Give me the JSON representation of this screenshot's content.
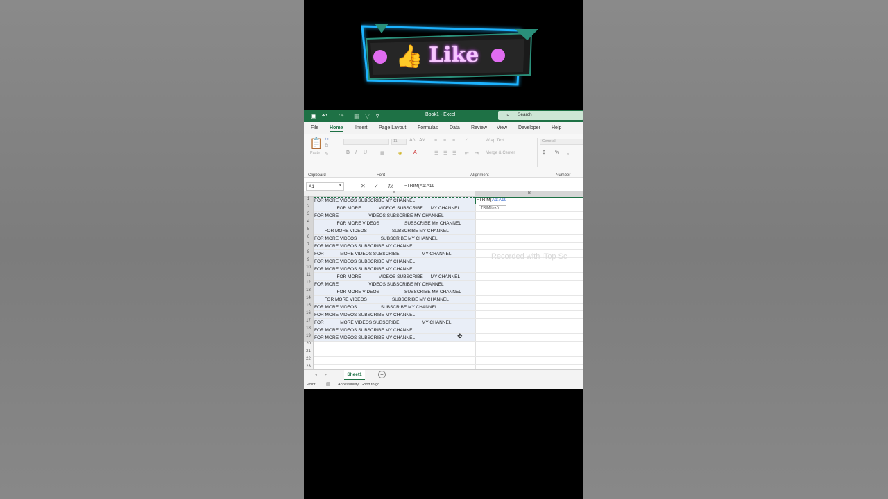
{
  "banner": {
    "like_label": "Like",
    "colors": {
      "glow": "#1fb3ff",
      "heart": "#e06cf0",
      "text": "#f7c6ff"
    }
  },
  "excel": {
    "window_title": "Book1 - Excel",
    "search_placeholder": "Search",
    "accent": "#1e7145",
    "tabs": [
      "File",
      "Home",
      "Insert",
      "Page Layout",
      "Formulas",
      "Data",
      "Review",
      "View",
      "Developer",
      "Help"
    ],
    "active_tab": "Home",
    "ribbon": {
      "groups": [
        "Clipboard",
        "Font",
        "Alignment",
        "Number"
      ],
      "paste_label": "Paste",
      "font_size": "11",
      "wrap_text": "Wrap Text",
      "merge_center": "Merge & Center",
      "number_format": "General",
      "bold": "B",
      "italic": "I",
      "underline": "U"
    },
    "name_box": "A1",
    "formula": "=TRIM(A1:A19",
    "columns": [
      "A",
      "B"
    ],
    "row_numbers": [
      "1",
      "2",
      "3",
      "4",
      "5",
      "6",
      "7",
      "8",
      "9",
      "10",
      "11",
      "12",
      "13",
      "14",
      "15",
      "16",
      "17",
      "18",
      "19",
      "20",
      "21",
      "22",
      "23"
    ],
    "cells_a": [
      "FOR MORE VIDEOS SUBSCRIBE MY CHANNEL",
      "                  FOR MORE              VIDEOS SUBSCRIBE      MY CHANNEL",
      "FOR MORE                        VIDEOS SUBSCRIBE MY CHANNEL",
      "                  FOR MORE VIDEOS                    SUBSCRIBE MY CHANNEL",
      "        FOR MORE VIDEOS                    SUBSCRIBE MY CHANNEL",
      "FOR MORE VIDEOS                   SUBSCRIBE MY CHANNEL",
      "FOR MORE VIDEOS SUBSCRIBE MY CHANNEL",
      "FOR             MORE VIDEOS SUBSCRIBE                  MY CHANNEL",
      "FOR MORE VIDEOS SUBSCRIBE MY CHANNEL",
      "FOR MORE VIDEOS SUBSCRIBE MY CHANNEL",
      "                  FOR MORE              VIDEOS SUBSCRIBE      MY CHANNEL",
      "FOR MORE                        VIDEOS SUBSCRIBE MY CHANNEL",
      "                  FOR MORE VIDEOS                    SUBSCRIBE MY CHANNEL",
      "        FOR MORE VIDEOS                    SUBSCRIBE MY CHANNEL",
      "FOR MORE VIDEOS                   SUBSCRIBE MY CHANNEL",
      "FOR MORE VIDEOS SUBSCRIBE MY CHANNEL",
      "FOR             MORE VIDEOS SUBSCRIBE                  MY CHANNEL",
      "FOR MORE VIDEOS SUBSCRIBE MY CHANNEL",
      "FOR MORE VIDEOS SUBSCRIBE MY CHANNEL"
    ],
    "active_cell_fn": "=TRIM(",
    "active_cell_ref": "A1:A19",
    "tooltip": "TRIM(text)",
    "watermark": "Recorded with iTop Sc",
    "sheet_tab": "Sheet1",
    "status_mode": "Point",
    "status_accessibility": "Accessibility: Good to go"
  }
}
